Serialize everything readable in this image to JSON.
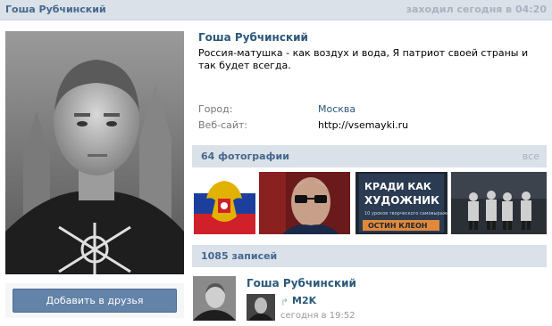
{
  "header": {
    "name": "Гоша Рубчинский",
    "last_seen": "заходил сегодня в 04:20"
  },
  "profile": {
    "name": "Гоша Рубчинский",
    "status": "Россия-матушка - как воздух и вода, Я патриот своей страны и так будет всегда.",
    "add_friend_label": "Добавить в друзья",
    "info": [
      {
        "label": "Город:",
        "value": "Москва"
      },
      {
        "label": "Веб-сайт:",
        "value": "http://vsemayki.ru"
      }
    ]
  },
  "photos": {
    "title": "64 фотографии",
    "more": "все",
    "items": [
      {
        "alt": "coat-of-arms",
        "caption": ""
      },
      {
        "alt": "portrait-glasses",
        "caption": ""
      },
      {
        "alt": "book-cover",
        "caption": "КРАДИ КАК ХУДОЖНИК"
      },
      {
        "alt": "group-photo",
        "caption": ""
      }
    ],
    "book_author": "ОСТИН КЛЕОН"
  },
  "wall": {
    "title": "1085 записей",
    "post": {
      "author": "Гоша Рубчинский",
      "repost_from": "M2K",
      "time": "сегодня в 19:52"
    }
  }
}
